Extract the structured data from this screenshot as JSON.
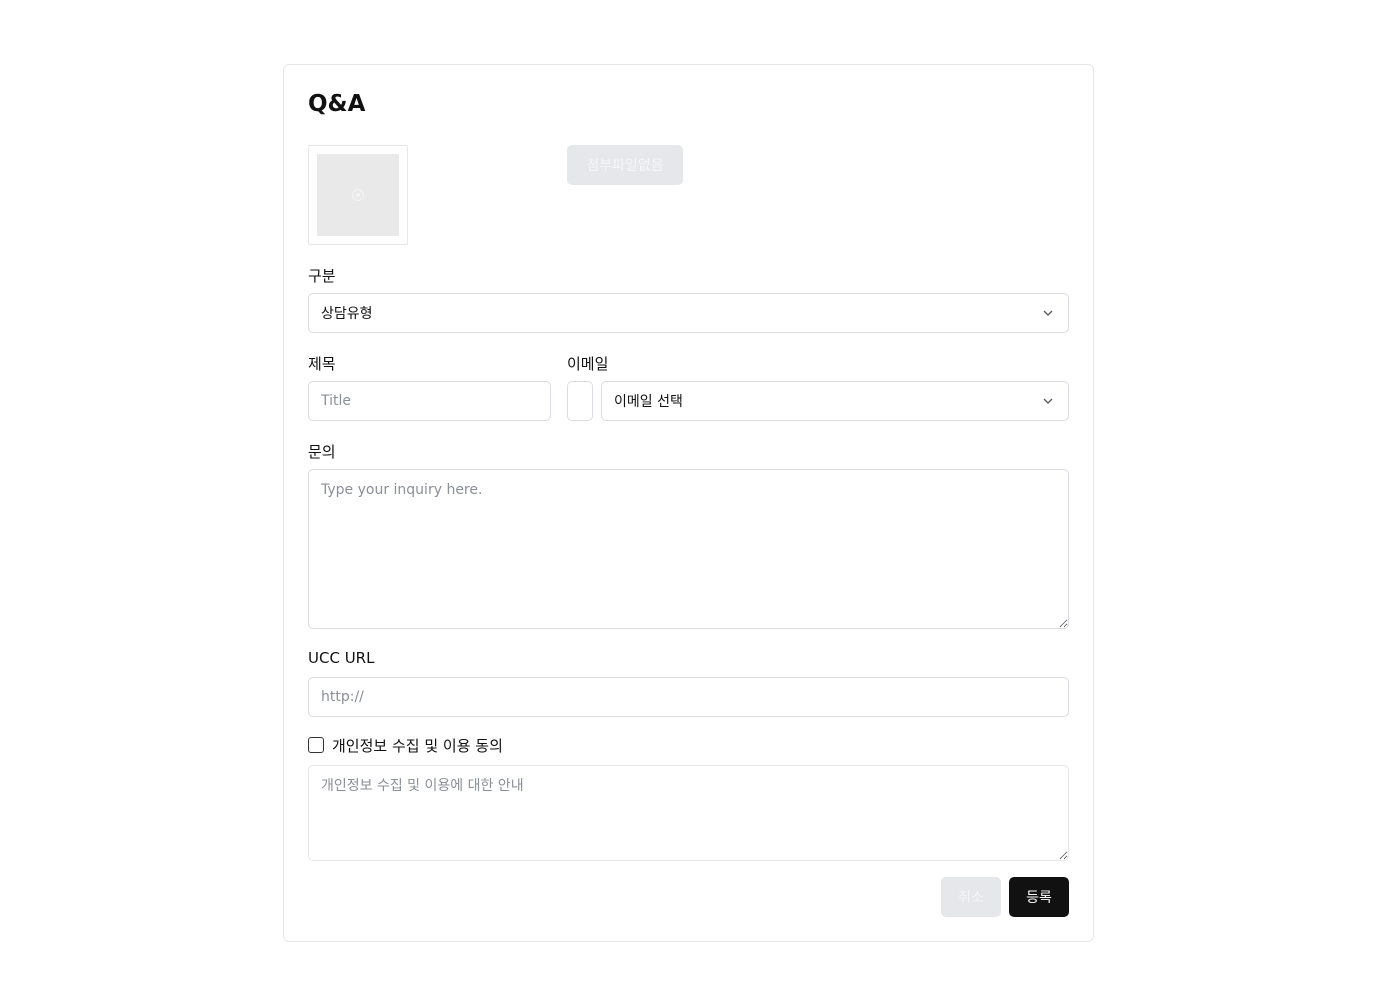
{
  "page": {
    "title": "Q&A"
  },
  "attachment": {
    "thumbnail_icon": "image-placeholder-icon",
    "button_label": "첨부파일없음"
  },
  "category": {
    "label": "구분",
    "selected": "상담유형",
    "icon": "chevron-down-icon"
  },
  "subject": {
    "label": "제목",
    "placeholder": "Title",
    "value": ""
  },
  "email": {
    "label": "이메일",
    "local_value": "",
    "domain_selected": "이메일 선택",
    "icon": "chevron-down-icon"
  },
  "inquiry": {
    "label": "문의",
    "placeholder": "Type your inquiry here.",
    "value": ""
  },
  "ucc": {
    "label": "UCC URL",
    "placeholder": "http://",
    "value": ""
  },
  "privacy": {
    "checkbox_label": "개인정보 수집 및 이용 동의",
    "checked": false,
    "notice_placeholder": "개인정보 수집 및 이용에 대한 안내"
  },
  "actions": {
    "cancel_label": "취소",
    "submit_label": "등록"
  },
  "colors": {
    "primary_button": "#111111",
    "disabled_button": "#e5e7eb",
    "border": "#d9dce1"
  }
}
